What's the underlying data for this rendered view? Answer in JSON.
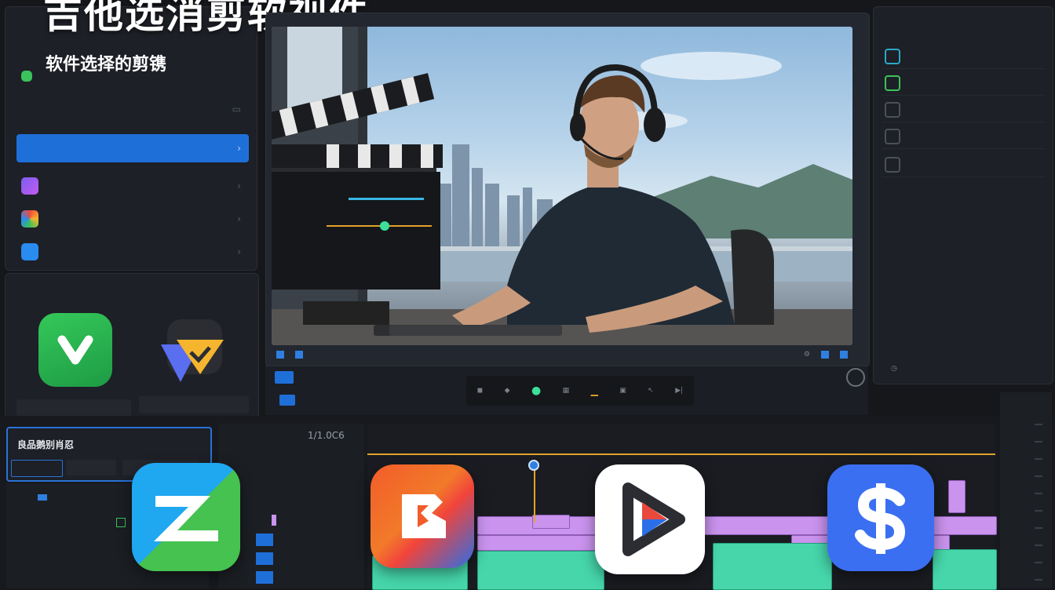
{
  "headline": {
    "title": "吉他选消剪软视件",
    "subtitle": "软件选择的剪镌"
  },
  "timeline": {
    "panel_title": "良品鹅别肖忍",
    "timecode": "1/1.0C6"
  },
  "colors": {
    "accent_blue": "#1f6fd9",
    "playhead_orange": "#e3a22b",
    "clip_purple": "#c993ee",
    "clip_green": "#46d6aa",
    "background": "#15171b"
  },
  "icons": {
    "left_apps": [
      "green-play-app-icon",
      "yellow-triangle-app-icon"
    ],
    "bottom_apps": [
      "zc-app-icon",
      "b-app-icon",
      "play-app-icon",
      "dollar-app-icon"
    ]
  }
}
